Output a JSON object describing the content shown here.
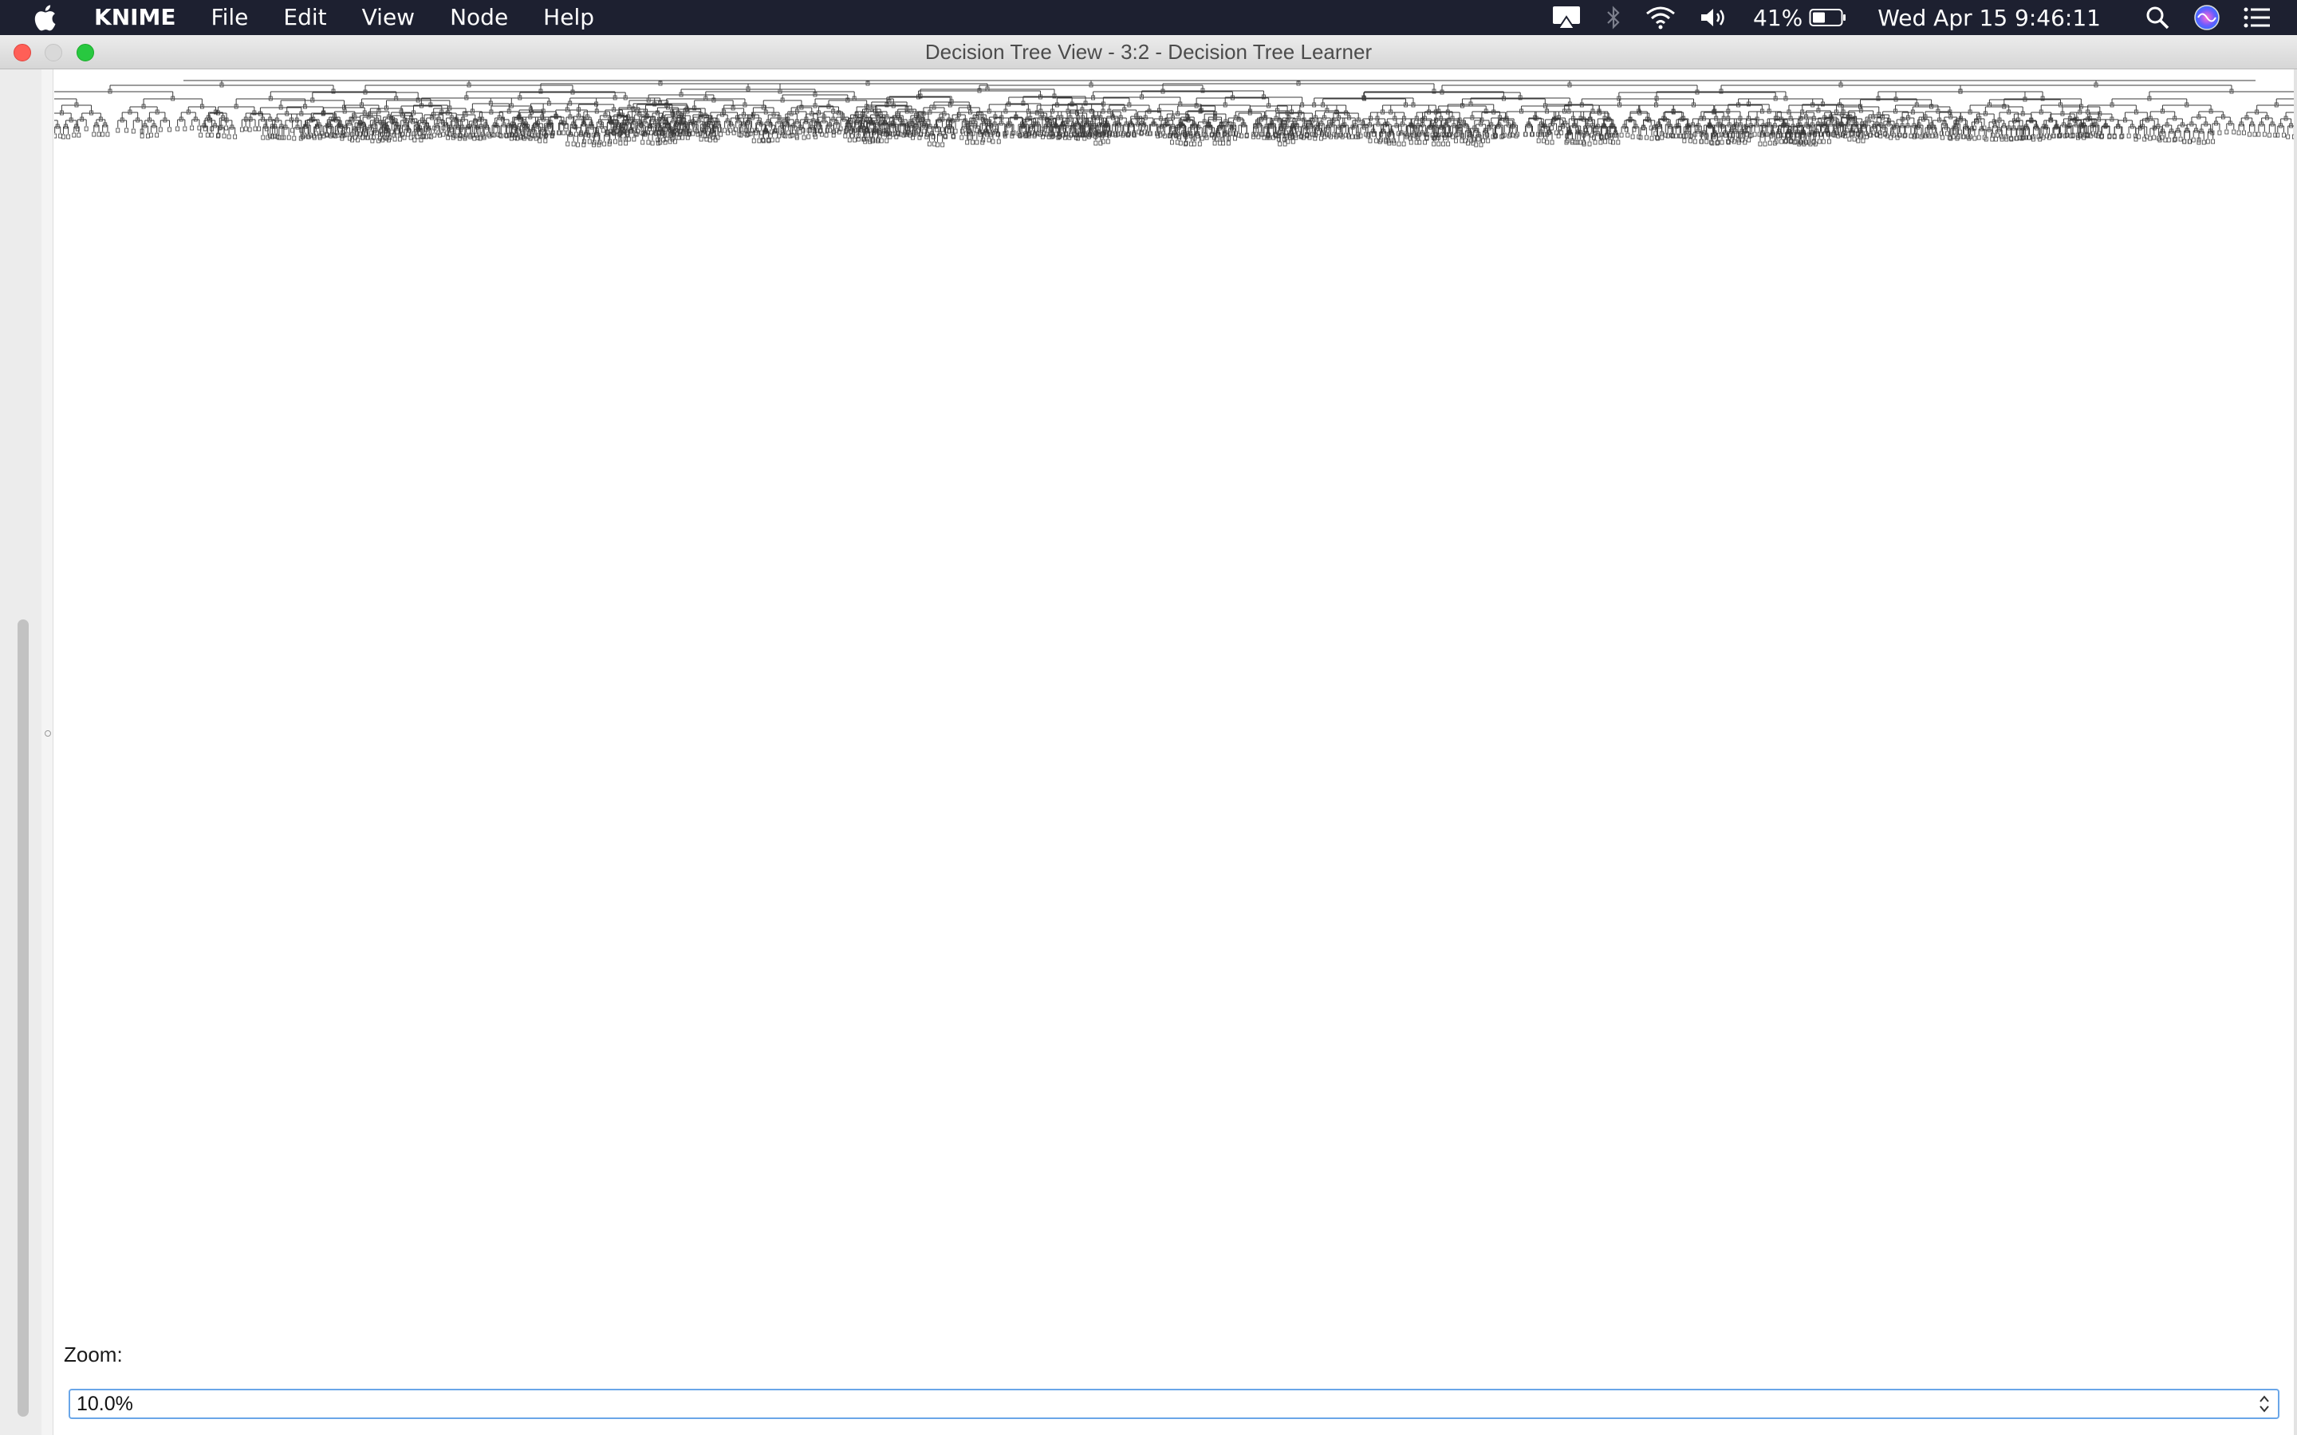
{
  "menubar": {
    "app_name": "KNIME",
    "menus": [
      "File",
      "Edit",
      "View",
      "Node",
      "Help"
    ],
    "battery_percent": "41%",
    "datetime": "Wed Apr 15  9:46:11",
    "icons": [
      "apple-icon",
      "airplay-icon",
      "bluetooth-icon",
      "wifi-icon",
      "volume-icon",
      "battery-icon",
      "spotlight-search-icon",
      "siri-icon",
      "notification-center-icon"
    ]
  },
  "window": {
    "title": "Decision Tree View - 3:2 - Decision Tree Learner"
  },
  "zoom": {
    "label": "Zoom:",
    "value": "10.0%"
  },
  "colors": {
    "menubar_bg": "#1d2030",
    "zoom_focus_ring": "#6aa6e8",
    "tree_stroke": "#3a3a3a"
  }
}
